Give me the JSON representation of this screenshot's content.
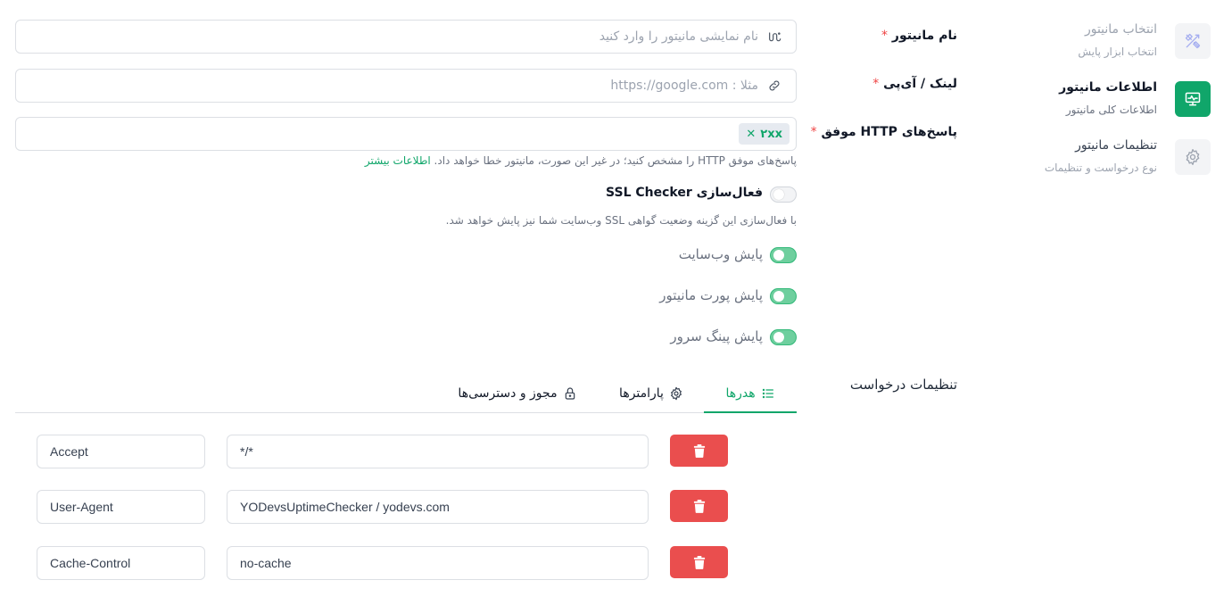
{
  "steps": [
    {
      "title": "انتخاب مانیتور",
      "subtitle": "انتخاب ابزار پایش",
      "icon": "tools-icon",
      "state": "done"
    },
    {
      "title": "اطلاعات مانیتور",
      "subtitle": "اطلاعات کلی مانیتور",
      "icon": "monitor-icon",
      "state": "active"
    },
    {
      "title": "تنظیمات مانیتور",
      "subtitle": "نوع درخواست و تنظیمات",
      "icon": "gear-icon",
      "state": "pending"
    }
  ],
  "form": {
    "name": {
      "label": "نام مانیتور",
      "required": "*",
      "placeholder": "نام نمایشی مانیتور را وارد کنید",
      "value": ""
    },
    "url": {
      "label": "لینک / آی‌پی",
      "required": "*",
      "placeholder": "مثلا : https://google.com",
      "value": ""
    },
    "http": {
      "label": "پاسخ‌های HTTP موفق",
      "required": "*",
      "tags": [
        "۲xx"
      ],
      "help": "پاسخ‌های موفق HTTP را مشخص کنید؛ در غیر این صورت، مانیتور خطا خواهد داد.",
      "help_link": "اطلاعات بیشتر"
    },
    "ssl": {
      "label": "فعال‌سازی SSL Checker",
      "checked": false,
      "help": "با فعال‌سازی این گزینه وضعیت گواهی SSL وب‌سایت شما نیز پایش خواهد شد."
    },
    "checks": [
      {
        "label": "پایش وب‌سایت",
        "checked": true
      },
      {
        "label": "پایش پورت مانیتور",
        "checked": true
      },
      {
        "label": "پایش پینگ سرور",
        "checked": true
      }
    ],
    "request_settings_label": "تنظیمات درخواست"
  },
  "tabs": [
    {
      "label": "هدرها",
      "icon": "list-icon",
      "active": true
    },
    {
      "label": "پارامترها",
      "icon": "gear-icon",
      "active": false
    },
    {
      "label": "مجوز و دسترسی‌ها",
      "icon": "lock-icon",
      "active": false
    }
  ],
  "headers": [
    {
      "key": "Accept",
      "value": "*/*"
    },
    {
      "key": "User-Agent",
      "value": "YODevsUptimeChecker / yodevs.com"
    },
    {
      "key": "Cache-Control",
      "value": "no-cache"
    }
  ],
  "colors": {
    "accent": "#10a66a",
    "danger": "#ea4e4e",
    "required": "#ef4444"
  }
}
